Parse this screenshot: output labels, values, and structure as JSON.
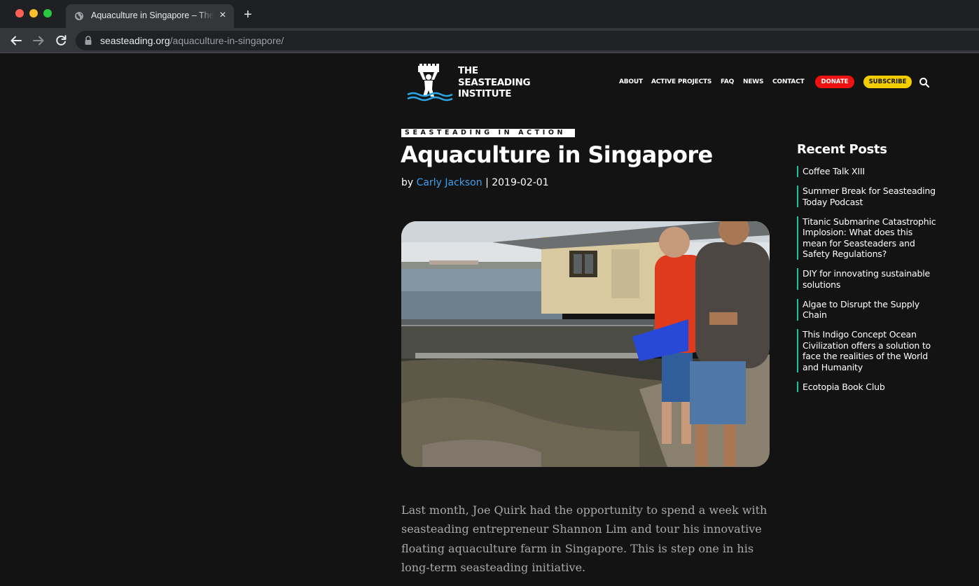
{
  "browser": {
    "tab_title": "Aquaculture in Singapore – The Seasteading Institute",
    "tab_close": "×",
    "new_tab": "+",
    "url_host": "seasteading.org",
    "url_path": "/aquaculture-in-singapore/"
  },
  "site": {
    "logo_lines": [
      "THE",
      "SEASTEADING",
      "INSTITUTE"
    ],
    "nav": {
      "about": "ABOUT",
      "active_projects": "ACTIVE PROJECTS",
      "faq": "FAQ",
      "news": "NEWS",
      "contact": "CONTACT",
      "donate": "DONATE",
      "subscribe": "SUBSCRIBE"
    },
    "colors": {
      "donate": "#ee1111",
      "subscribe": "#f2cd00",
      "link": "#3fa0ef",
      "sidebar_accent": "#19c2a8"
    }
  },
  "post": {
    "category": "SEASTEADING IN ACTION",
    "title": "Aquaculture in Singapore",
    "by": "by",
    "author": "Carly Jackson",
    "separator": "|",
    "date": "2019-02-01",
    "body": "Last month, Joe Quirk had the opportunity to spend a week with seasteading entrepreneur Shannon Lim and tour his innovative floating aquaculture farm in Singapore. This is step one in his long-term seasteading initiative."
  },
  "sidebar": {
    "title": "Recent Posts",
    "posts": [
      "Coffee Talk XIII",
      "Summer Break for Seasteading Today Podcast",
      "Titanic Submarine Catastrophic Implosion: What does this mean for Seasteaders and Safety Regulations?",
      "DIY for innovating sustainable solutions",
      "Algae to Disrupt the Supply Chain",
      "This Indigo Concept Ocean Civilization offers a solution to face the realities of the World and Humanity",
      "Ecotopia Book Club"
    ]
  }
}
